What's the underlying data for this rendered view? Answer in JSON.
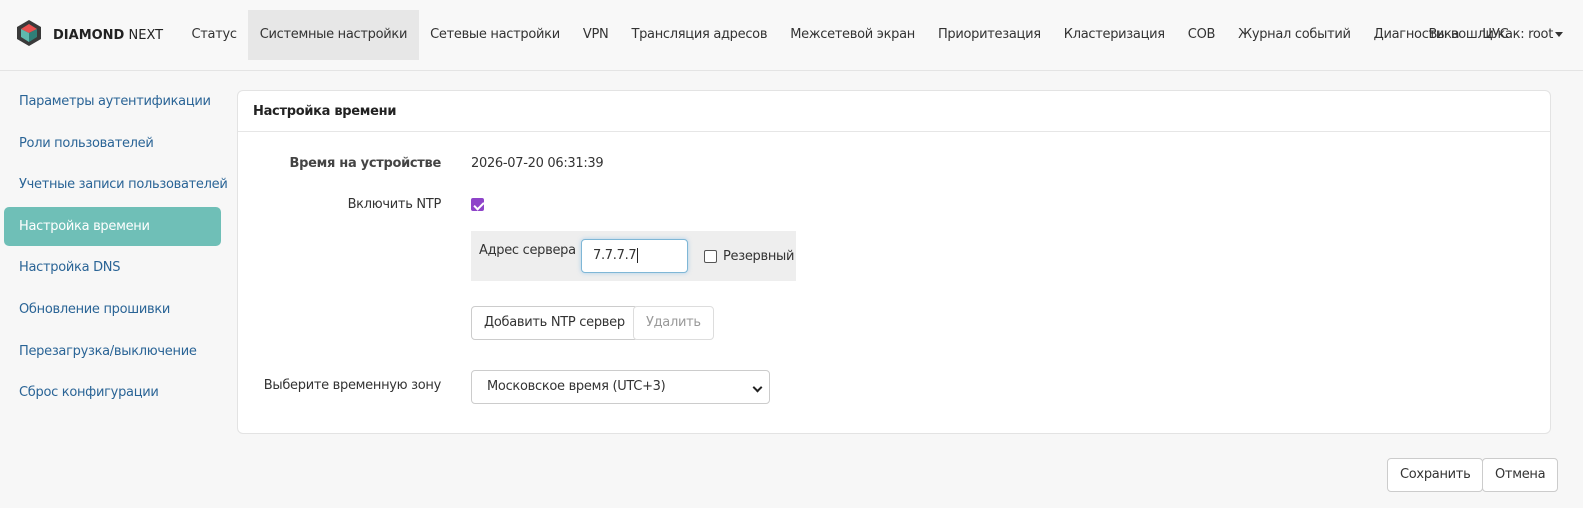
{
  "app": {
    "brand_bold": "DIAMOND",
    "brand_light": "NEXT",
    "logo_icon": "diamond-logo-icon"
  },
  "nav": {
    "items": [
      {
        "label": "Статус"
      },
      {
        "label": "Системные настройки",
        "active": true
      },
      {
        "label": "Сетевые настройки"
      },
      {
        "label": "VPN"
      },
      {
        "label": "Трансляция адресов"
      },
      {
        "label": "Межсетевой экран"
      },
      {
        "label": "Приоритезация"
      },
      {
        "label": "Кластеризация"
      },
      {
        "label": "СОВ"
      },
      {
        "label": "Журнал событий"
      },
      {
        "label": "Диагностика"
      },
      {
        "label": "ЦУС"
      }
    ],
    "user_label": "Вы вошли как: root"
  },
  "sidebar": {
    "items": [
      {
        "label": "Параметры аутентификации"
      },
      {
        "label": "Роли пользователей"
      },
      {
        "label": "Учетные записи пользователей"
      },
      {
        "label": "Настройка времени",
        "active": true
      },
      {
        "label": "Настройка DNS"
      },
      {
        "label": "Обновление прошивки"
      },
      {
        "label": "Перезагрузка/выключение"
      },
      {
        "label": "Сброс конфигурации"
      }
    ]
  },
  "panel": {
    "title": "Настройка времени",
    "device_time_label": "Время на устройстве",
    "device_time_value": "2026-07-20 06:31:39",
    "ntp_enable_label": "Включить NTP",
    "ntp_enabled": true,
    "server_address_label": "Адрес сервера",
    "server_address_value": "7.7.7.7",
    "reserve_label": "Резервный",
    "reserve_checked": false,
    "add_ntp_button": "Добавить NTP сервер",
    "delete_button": "Удалить",
    "timezone_label": "Выберите временную зону",
    "timezone_value": "Московское время (UTC+3)"
  },
  "footer": {
    "save_button": "Сохранить",
    "cancel_button": "Отмена"
  },
  "colors": {
    "accent": "#6fbfb7",
    "link": "#2a6496",
    "checkbox": "#8e44c9"
  }
}
